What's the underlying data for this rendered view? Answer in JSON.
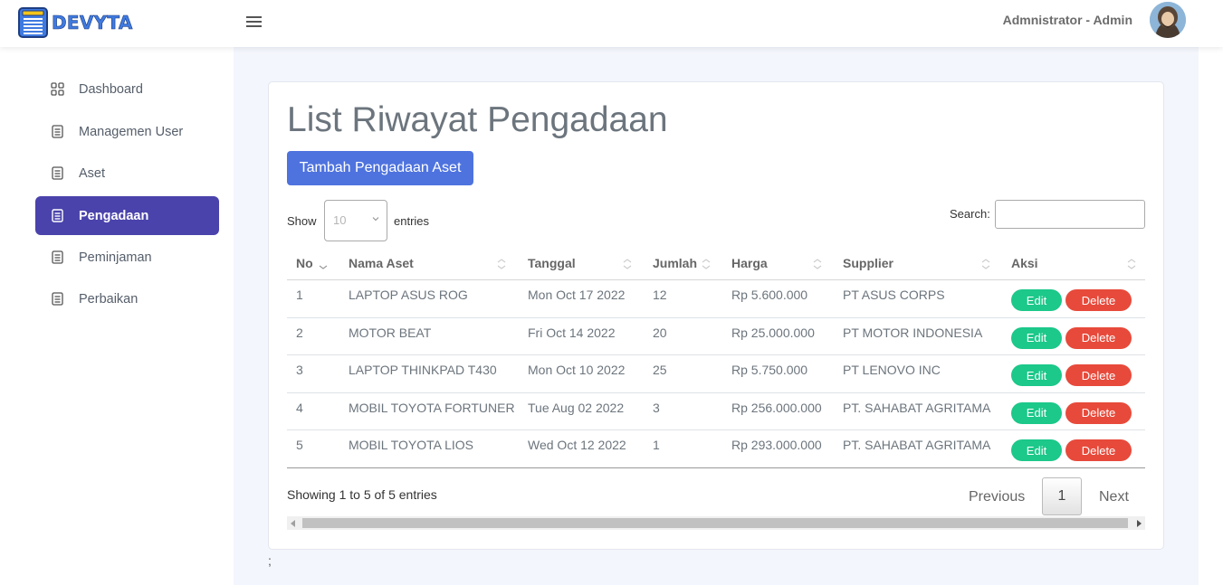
{
  "brand": {
    "name": "DEVYTA"
  },
  "header": {
    "user_label": "Admnistrator - Admin"
  },
  "sidebar": {
    "items": [
      {
        "label": "Dashboard",
        "icon": "grid-icon",
        "active": false
      },
      {
        "label": "Managemen User",
        "icon": "document-icon",
        "active": false
      },
      {
        "label": "Aset",
        "icon": "document-icon",
        "active": false
      },
      {
        "label": "Pengadaan",
        "icon": "document-icon",
        "active": true
      },
      {
        "label": "Peminjaman",
        "icon": "document-icon",
        "active": false
      },
      {
        "label": "Perbaikan",
        "icon": "document-icon",
        "active": false
      }
    ]
  },
  "main": {
    "title": "List Riwayat Pengadaan",
    "add_button": "Tambah Pengadaan Aset",
    "length": {
      "show": "Show",
      "value": "10",
      "entries": "entries"
    },
    "search": {
      "label": "Search:",
      "value": ""
    },
    "table": {
      "columns": [
        "No",
        "Nama Aset",
        "Tanggal",
        "Jumlah",
        "Harga",
        "Supplier",
        "Aksi"
      ],
      "rows": [
        [
          "1",
          "LAPTOP ASUS ROG",
          "Mon Oct 17 2022",
          "12",
          "Rp 5.600.000",
          "PT ASUS CORPS"
        ],
        [
          "2",
          "MOTOR BEAT",
          "Fri Oct 14 2022",
          "20",
          "Rp 25.000.000",
          "PT MOTOR INDONESIA"
        ],
        [
          "3",
          "LAPTOP THINKPAD T430",
          "Mon Oct 10 2022",
          "25",
          "Rp 5.750.000",
          "PT LENOVO INC"
        ],
        [
          "4",
          "MOBIL TOYOTA FORTUNER",
          "Tue Aug 02 2022",
          "3",
          "Rp 256.000.000",
          "PT. SAHABAT AGRITAMA"
        ],
        [
          "5",
          "MOBIL TOYOTA LIOS",
          "Wed Oct 12 2022",
          "1",
          "Rp 293.000.000",
          "PT. SAHABAT AGRITAMA"
        ]
      ],
      "edit_label": "Edit",
      "delete_label": "Delete"
    },
    "info": "Showing 1 to 5 of 5 entries",
    "pagination": {
      "previous": "Previous",
      "current": "1",
      "next": "Next"
    },
    "footer_text": ";"
  },
  "colors": {
    "primary": "#4e73df",
    "sidebar_active": "#4a43ab",
    "success": "#1cc88a",
    "danger": "#e74a3b",
    "brand": "#3f7ae0"
  }
}
